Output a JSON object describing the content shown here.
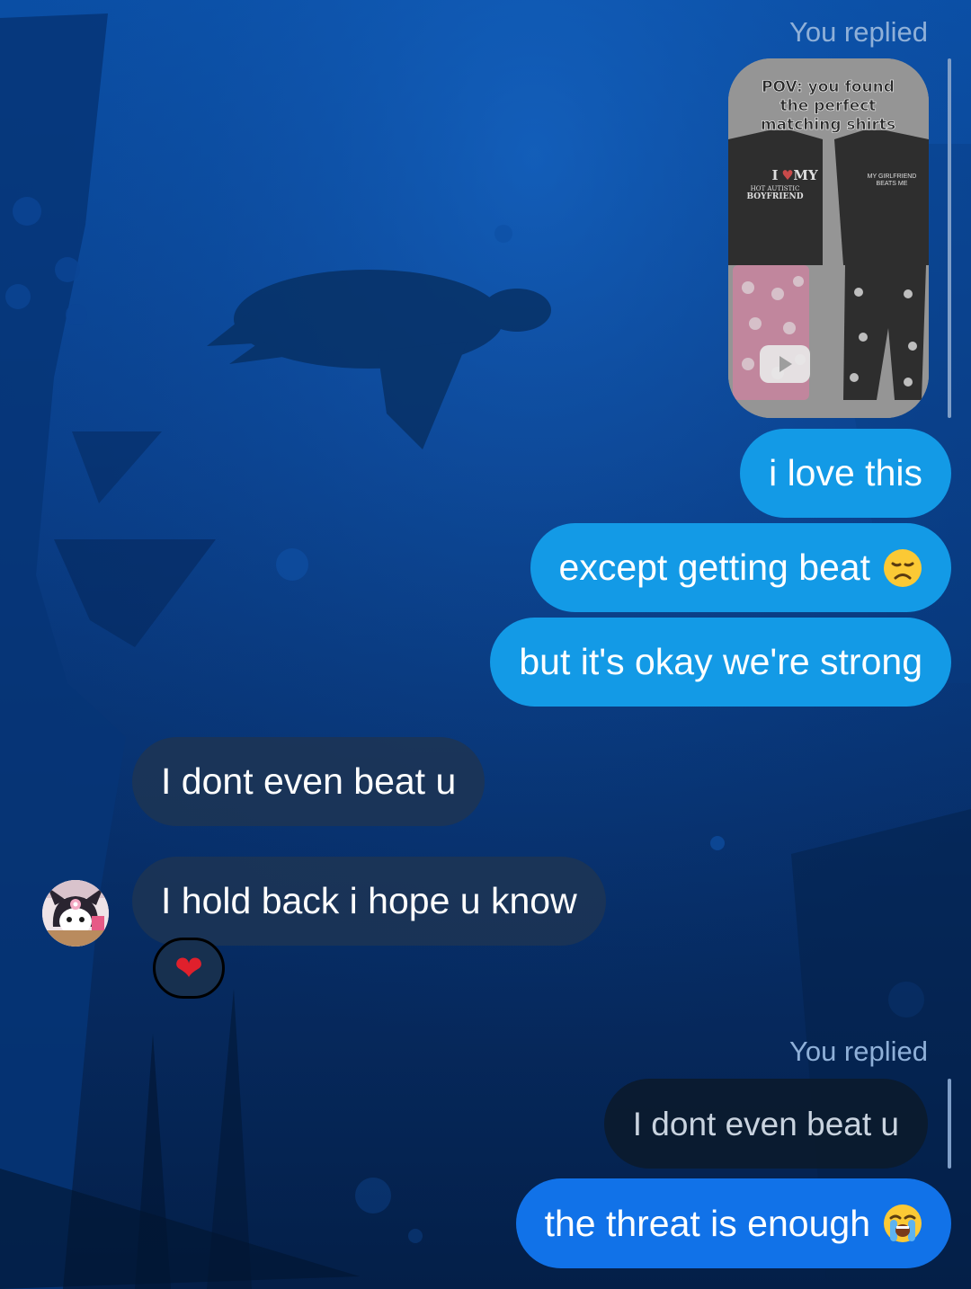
{
  "colors": {
    "outgoing": "#139ae6",
    "outgoing_last": "#1172e8",
    "incoming": "#1c3454",
    "reply_label": "#8fb0d8",
    "reaction_heart": "#e0202c"
  },
  "thread": {
    "reply_1": {
      "label": "You replied",
      "media": {
        "caption": "POV: you found the perfect matching shirts",
        "shirt_left": "I ♥ MY HOT AUTISTIC BOYFRIEND",
        "shirt_right": "MY GIRLFRIEND BEATS ME",
        "icon": "play-icon"
      }
    },
    "outgoing_1": "i love this",
    "outgoing_2": "except getting beat",
    "outgoing_2_emoji": "disappointed-face",
    "outgoing_3": "but it's okay we're strong",
    "incoming_1": "I dont even beat u",
    "incoming_2": "I hold back i hope u know",
    "incoming_2_reaction": "❤",
    "reply_2": {
      "label": "You replied",
      "quoted": "I dont even beat u"
    },
    "outgoing_4": "the threat is enough",
    "outgoing_4_emoji": "loudly-crying-face"
  }
}
